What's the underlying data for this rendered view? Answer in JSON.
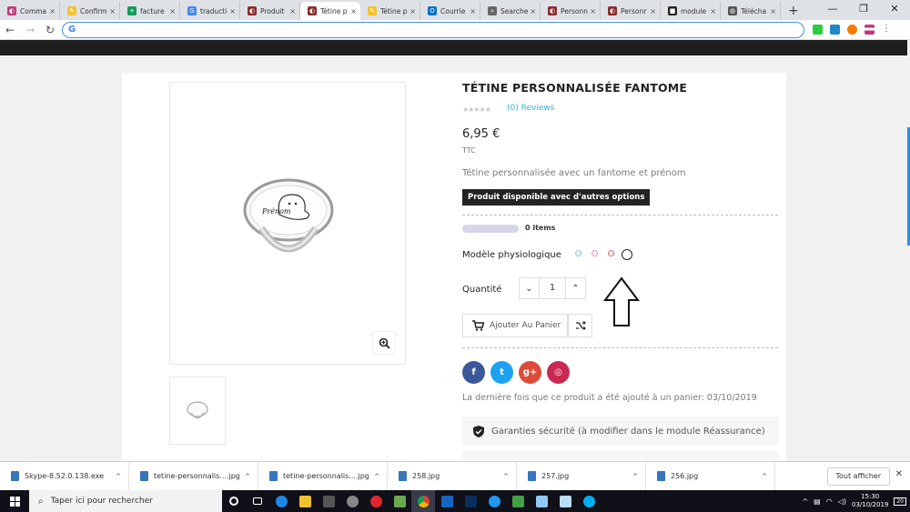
{
  "browser": {
    "tabs": [
      {
        "title": "Comma",
        "color": "#c0397a",
        "glyph": "◐"
      },
      {
        "title": "Confirm",
        "color": "#f2c12e",
        "glyph": "✎"
      },
      {
        "title": "facture",
        "color": "#0f9d58",
        "glyph": "+"
      },
      {
        "title": "traducti",
        "color": "#4285f4",
        "glyph": "G"
      },
      {
        "title": "Produit",
        "color": "#8a2b2b",
        "glyph": "◐"
      },
      {
        "title": "Tétine p",
        "color": "#8a2b2b",
        "glyph": "◐",
        "active": true
      },
      {
        "title": "Tétine p",
        "color": "#f2c12e",
        "glyph": "✎"
      },
      {
        "title": "Courrie",
        "color": "#0072c6",
        "glyph": "O"
      },
      {
        "title": "Searche",
        "color": "#666666",
        "glyph": "⌕"
      },
      {
        "title": "Personn",
        "color": "#8a2b2b",
        "glyph": "◐"
      },
      {
        "title": "Personr",
        "color": "#8a2b2b",
        "glyph": "◐"
      },
      {
        "title": "module",
        "color": "#222222",
        "glyph": "■"
      },
      {
        "title": "Télécha",
        "color": "#555555",
        "glyph": "◍"
      }
    ],
    "address_glyph": "G",
    "tab_close": "×",
    "new_tab": "+"
  },
  "product": {
    "title": "TÉTINE PERSONNALISÉE FANTOME",
    "stars": "★★★★★",
    "reviews": "(0) Reviews",
    "price": "6,95 €",
    "tax_label": "TTC",
    "description": "Tétine personnalisée avec un fantome et prénom",
    "availability": "Produit disponible avec d'autres options",
    "progress_items": "0 items",
    "variant_label": "Modèle physiologique",
    "quantity_label": "Quantité",
    "quantity_value": "1",
    "add_to_cart": "Ajouter Au Panier",
    "pacifier_name": "Prénom",
    "last_added": "La dernière fois que ce produit a été ajouté à un panier: 03/10/2019",
    "reassurance": "Garanties sécurité (à modifier dans le module Réassurance)"
  },
  "social": [
    {
      "name": "facebook",
      "label": "f",
      "color": "#3b5998"
    },
    {
      "name": "twitter",
      "label": "t",
      "color": "#1da1f2"
    },
    {
      "name": "googleplus",
      "label": "g+",
      "color": "#dd4b39"
    },
    {
      "name": "instagram",
      "label": "◎",
      "color": "#c92a51"
    }
  ],
  "downloads": [
    {
      "name": "Skype-8.52.0.138.exe"
    },
    {
      "name": "tetine-personnalis....jpg"
    },
    {
      "name": "tetine-personnalis....jpg"
    },
    {
      "name": "258.jpg"
    },
    {
      "name": "257.jpg"
    },
    {
      "name": "256.jpg"
    }
  ],
  "downloads_show_all": "Tout afficher",
  "downloads_up": "^",
  "taskbar": {
    "search_placeholder": "Taper ici pour rechercher",
    "time": "15:30",
    "date": "03/10/2019",
    "notif": "20"
  },
  "colors": {
    "accent": "#2fb5d2",
    "dark": "#232323"
  }
}
